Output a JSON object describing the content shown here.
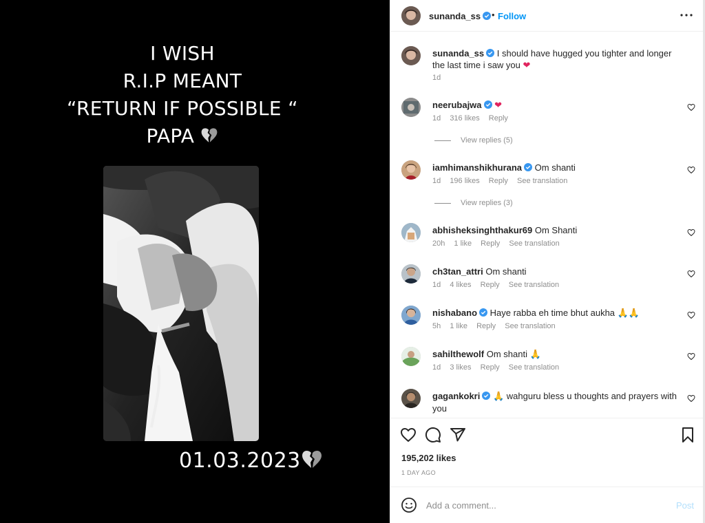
{
  "media": {
    "quote_lines": [
      "I WISH",
      "R.I.P MEANT",
      "“RETURN IF POSSIBLE “",
      "PAPA"
    ],
    "date": "01.03.2023"
  },
  "header": {
    "username": "sunanda_ss",
    "separator": "•",
    "follow_label": "Follow"
  },
  "caption": {
    "username": "sunanda_ss",
    "text": "I should have hugged you tighter and longer the last time i saw you",
    "time": "1d"
  },
  "comments": [
    {
      "username": "neerubajwa",
      "text": "",
      "time": "1d",
      "likes": "316 likes",
      "reply": "Reply",
      "translation": "",
      "view_replies": "View replies (5)"
    },
    {
      "username": "iamhimanshikhurana",
      "text": "Om shanti",
      "time": "1d",
      "likes": "196 likes",
      "reply": "Reply",
      "translation": "See translation",
      "view_replies": "View replies (3)"
    },
    {
      "username": "abhisheksinghthakur69",
      "text": "Om Shanti",
      "time": "20h",
      "likes": "1 like",
      "reply": "Reply",
      "translation": "See translation",
      "view_replies": ""
    },
    {
      "username": "ch3tan_attri",
      "text": "Om shanti",
      "time": "1d",
      "likes": "4 likes",
      "reply": "Reply",
      "translation": "See translation",
      "view_replies": ""
    },
    {
      "username": "nishabano",
      "text": "Haye rabba eh time bhut aukha",
      "time": "5h",
      "likes": "1 like",
      "reply": "Reply",
      "translation": "See translation",
      "view_replies": ""
    },
    {
      "username": "sahilthewolf",
      "text": "Om shanti",
      "time": "1d",
      "likes": "3 likes",
      "reply": "Reply",
      "translation": "See translation",
      "view_replies": ""
    },
    {
      "username": "gagankokri",
      "text": "wahguru bless u thoughts and prayers with you",
      "time": "",
      "likes": "",
      "reply": "",
      "translation": "",
      "view_replies": ""
    }
  ],
  "stats": {
    "likes": "195,202 likes",
    "posted": "1 DAY AGO"
  },
  "composer": {
    "placeholder": "Add a comment...",
    "post_label": "Post"
  },
  "colors": {
    "accent": "#0095f6",
    "verified": "#3897f0",
    "heart": "#e0245e",
    "muted": "#8e8e8e"
  }
}
